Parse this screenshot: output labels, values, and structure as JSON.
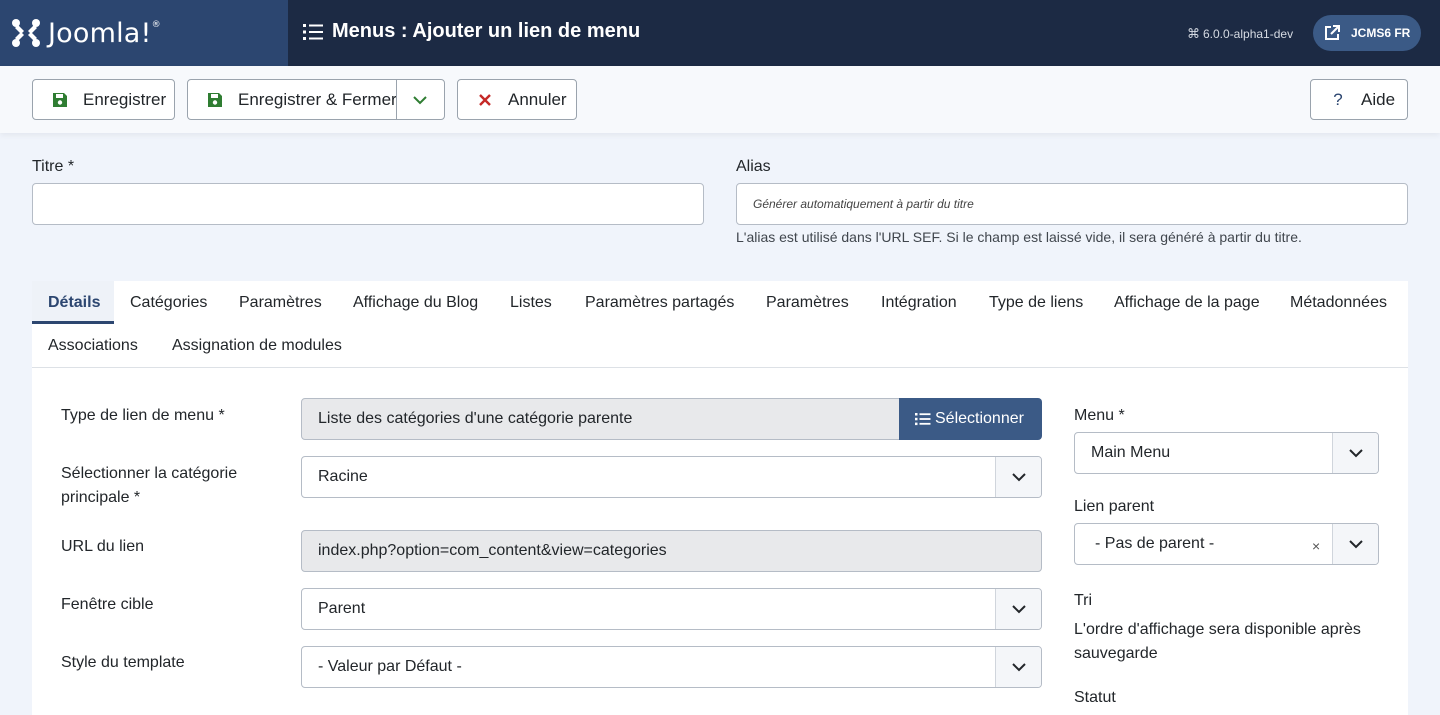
{
  "header": {
    "logo_text": "Joomla!",
    "page_title": "Menus : Ajouter un lien de menu",
    "version": "6.0.0-alpha1-dev",
    "site_label": "JCMS6 FR"
  },
  "toolbar": {
    "save_label": "Enregistrer",
    "save_close_label": "Enregistrer & Fermer",
    "cancel_label": "Annuler",
    "help_label": "Aide"
  },
  "form": {
    "title_label": "Titre *",
    "title_value": "",
    "alias_label": "Alias",
    "alias_placeholder": "Générer automatiquement à partir du titre",
    "alias_hint": "L'alias est utilisé dans l'URL SEF. Si le champ est laissé vide, il sera généré à partir du titre."
  },
  "tabs": [
    "Détails",
    "Catégories",
    "Paramètres",
    "Affichage du Blog",
    "Listes",
    "Paramètres partagés",
    "Paramètres",
    "Intégration",
    "Type de liens",
    "Affichage de la page",
    "Métadonnées",
    "Associations",
    "Assignation de modules"
  ],
  "details": {
    "menu_type_label": "Type de lien de menu *",
    "menu_type_value": "Liste des catégories d'une catégorie parente",
    "select_button": "Sélectionner",
    "main_category_label_1": "Sélectionner la catégorie",
    "main_category_label_2": "principale *",
    "main_category_value": "Racine",
    "url_label": "URL du lien",
    "url_value": "index.php?option=com_content&view=categories",
    "target_label": "Fenêtre cible",
    "target_value": "Parent",
    "template_label": "Style du template",
    "template_value": "- Valeur par Défaut -"
  },
  "sidebar": {
    "menu_label": "Menu *",
    "menu_value": "Main Menu",
    "parent_label": "Lien parent",
    "parent_value": "- Pas de parent -",
    "clear_glyph": "×",
    "order_label": "Tri",
    "order_text_1": "L'ordre d'affichage sera disponible après",
    "order_text_2": "sauvegarde",
    "status_label": "Statut"
  }
}
